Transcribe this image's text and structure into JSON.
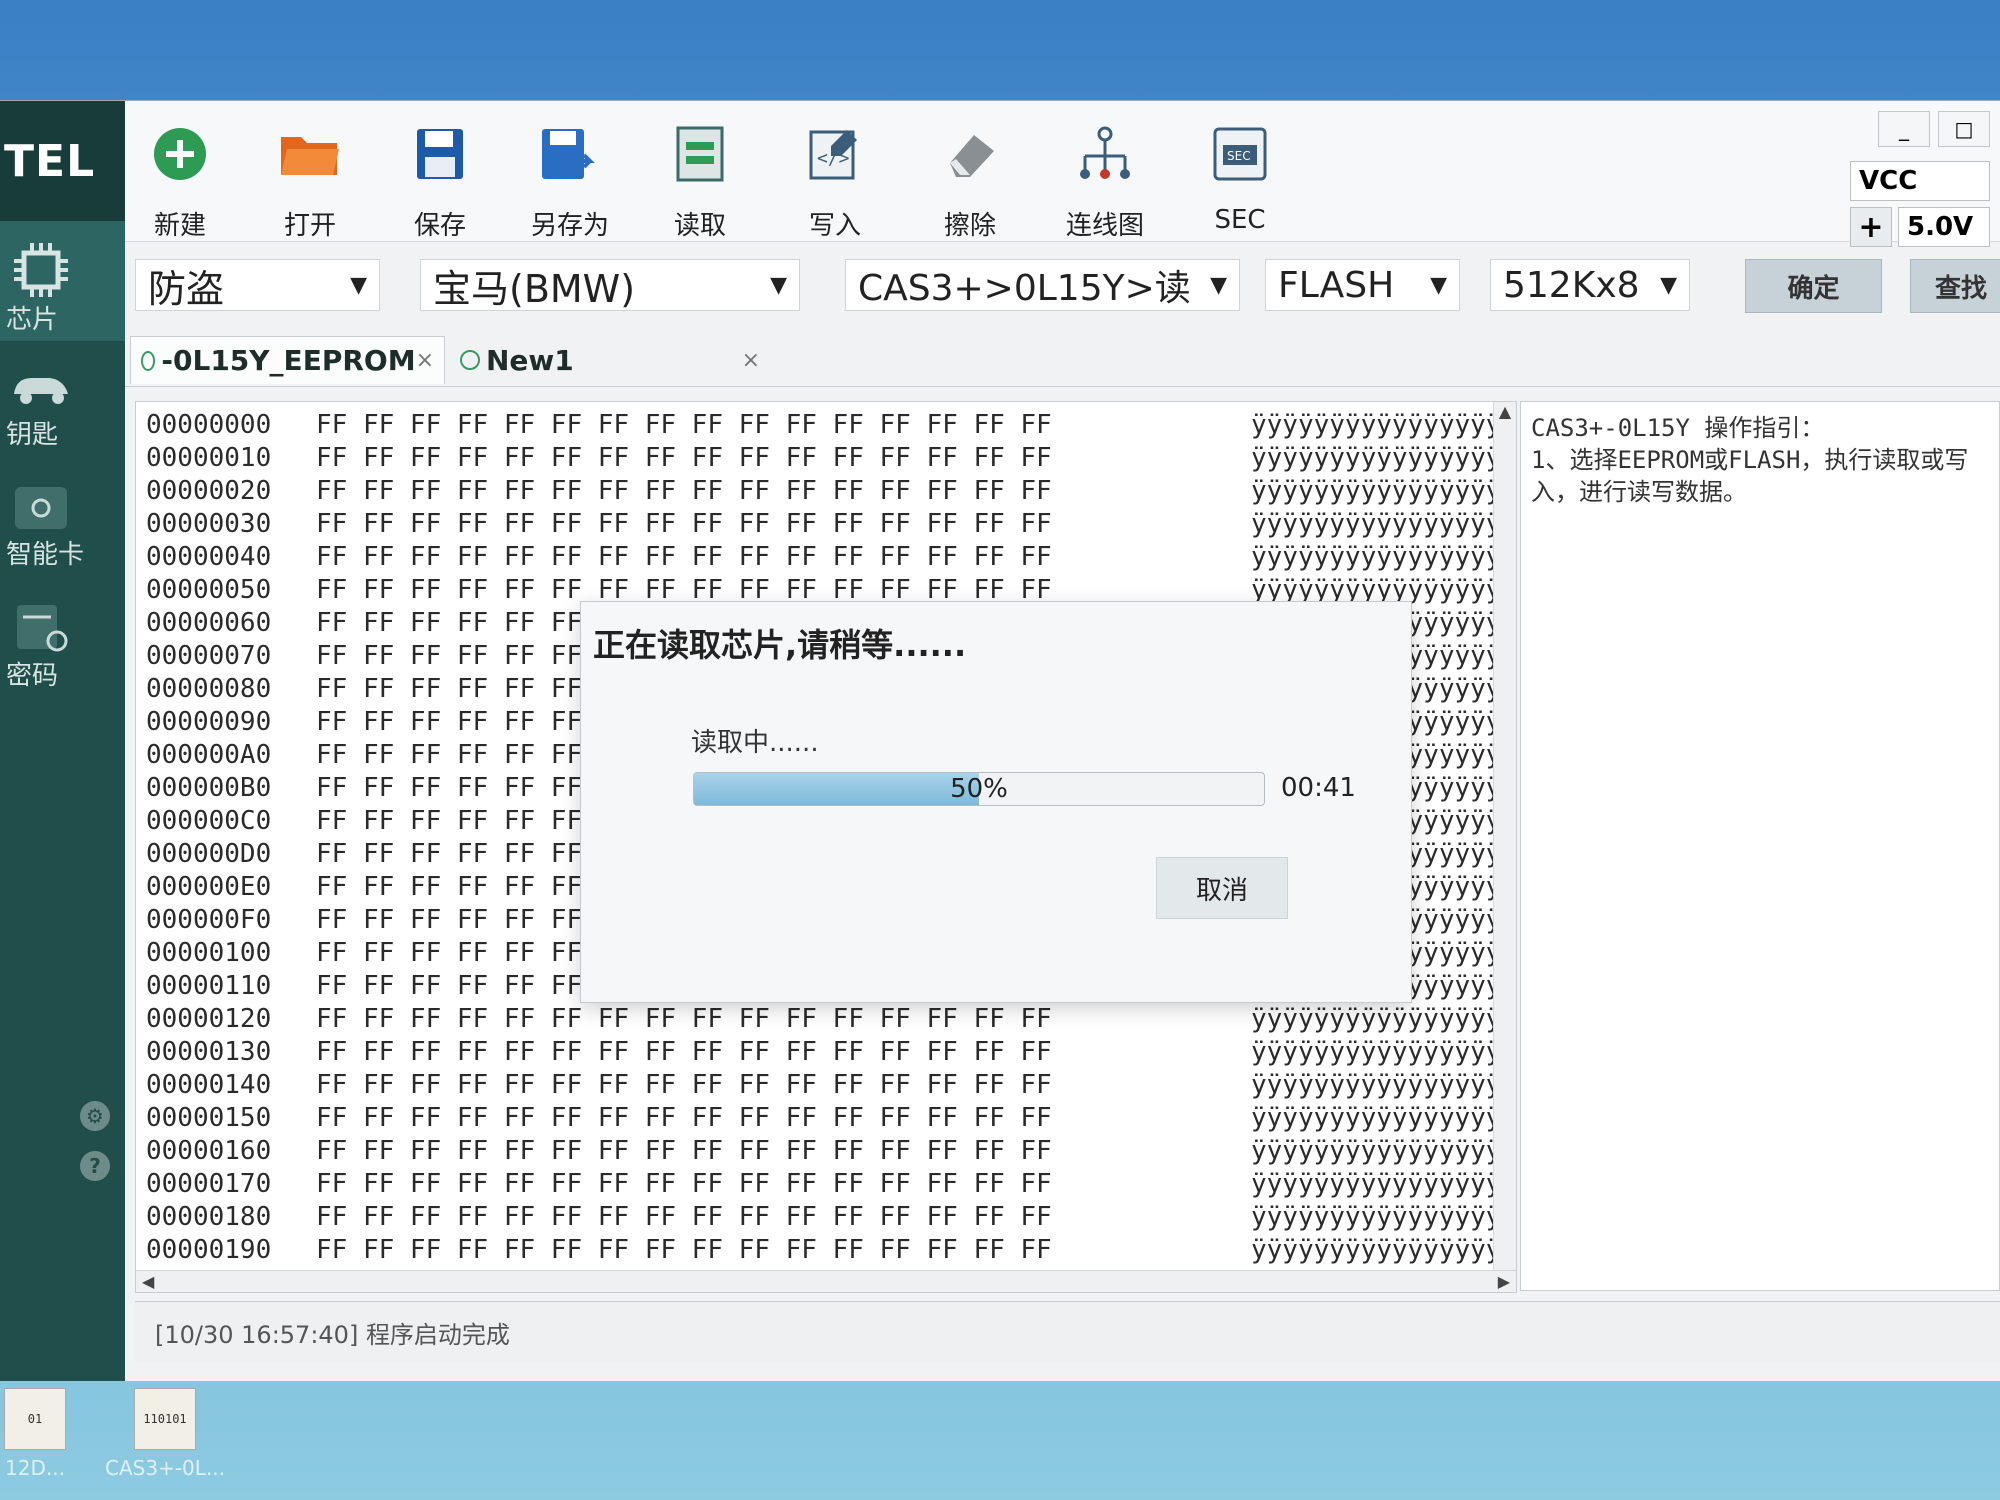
{
  "app": {
    "logo": "TEL"
  },
  "sidebar": {
    "items": [
      {
        "label": "芯片",
        "icon": "chip-icon"
      },
      {
        "label": "钥匙",
        "icon": "car-key-icon"
      },
      {
        "label": "智能卡",
        "icon": "smart-card-icon"
      },
      {
        "label": "密码",
        "icon": "password-icon"
      }
    ],
    "footer_icons": [
      "gear-icon",
      "home-icon",
      "help-icon",
      "info-icon"
    ]
  },
  "toolbar": {
    "buttons": [
      {
        "label": "新建",
        "icon": "new-icon"
      },
      {
        "label": "打开",
        "icon": "folder-icon"
      },
      {
        "label": "保存",
        "icon": "save-icon"
      },
      {
        "label": "另存为",
        "icon": "save-as-icon"
      },
      {
        "label": "读取",
        "icon": "read-icon"
      },
      {
        "label": "写入",
        "icon": "write-icon"
      },
      {
        "label": "擦除",
        "icon": "eraser-icon"
      },
      {
        "label": "连线图",
        "icon": "wiring-icon"
      },
      {
        "label": "SEC",
        "icon": "sec-icon"
      }
    ],
    "vcc": {
      "label": "VCC",
      "plus": "+",
      "value": "5.0V"
    },
    "window_controls": [
      "_",
      "□"
    ]
  },
  "selectors": {
    "category": "防盗",
    "brand": "宝马(BMW)",
    "module": "CAS3+>0L15Y>读",
    "memory": "FLASH",
    "size": "512Kx8",
    "confirm": "确定",
    "search": "查找"
  },
  "tabs": [
    {
      "label": "-0L15Y_EEPROM",
      "close": "×"
    },
    {
      "label": "New1",
      "close": "×"
    }
  ],
  "hex": {
    "rows": [
      {
        "addr": "00000000",
        "bytes": "FF FF FF FF FF FF FF FF FF FF FF FF FF FF FF FF",
        "ascii": "ÿÿÿÿÿÿÿÿÿÿÿÿÿÿÿÿ"
      },
      {
        "addr": "00000010",
        "bytes": "FF FF FF FF FF FF FF FF FF FF FF FF FF FF FF FF",
        "ascii": "ÿÿÿÿÿÿÿÿÿÿÿÿÿÿÿÿ"
      },
      {
        "addr": "00000020",
        "bytes": "FF FF FF FF FF FF FF FF FF FF FF FF FF FF FF FF",
        "ascii": "ÿÿÿÿÿÿÿÿÿÿÿÿÿÿÿÿ"
      },
      {
        "addr": "00000030",
        "bytes": "FF FF FF FF FF FF FF FF FF FF FF FF FF FF FF FF",
        "ascii": "ÿÿÿÿÿÿÿÿÿÿÿÿÿÿÿÿ"
      },
      {
        "addr": "00000040",
        "bytes": "FF FF FF FF FF FF FF FF FF FF FF FF FF FF FF FF",
        "ascii": "ÿÿÿÿÿÿÿÿÿÿÿÿÿÿÿÿ"
      },
      {
        "addr": "00000050",
        "bytes": "FF FF FF FF FF FF FF FF FF FF FF FF FF FF FF FF",
        "ascii": "ÿÿÿÿÿÿÿÿÿÿÿÿÿÿÿÿ"
      },
      {
        "addr": "00000060",
        "bytes": "FF FF FF FF FF FF FF FF FF FF FF FF FF FF FF FF",
        "ascii": "ÿÿÿÿÿÿÿÿÿÿÿÿÿÿÿÿ"
      },
      {
        "addr": "00000070",
        "bytes": "FF FF FF FF FF FF FF FF FF FF FF FF FF FF FF FF",
        "ascii": "ÿÿÿÿÿÿÿÿÿÿÿÿÿÿÿÿ"
      },
      {
        "addr": "00000080",
        "bytes": "FF FF FF FF FF FF FF FF FF FF FF FF FF FF FF FF",
        "ascii": "ÿÿÿÿÿÿÿÿÿÿÿÿÿÿÿÿ"
      },
      {
        "addr": "00000090",
        "bytes": "FF FF FF FF FF FF FF FF FF FF FF FF FF FF FF FF",
        "ascii": "ÿÿÿÿÿÿÿÿÿÿÿÿÿÿÿÿ"
      },
      {
        "addr": "000000A0",
        "bytes": "FF FF FF FF FF FF FF FF FF FF FF FF FF FF FF FF",
        "ascii": "ÿÿÿÿÿÿÿÿÿÿÿÿÿÿÿÿ"
      },
      {
        "addr": "000000B0",
        "bytes": "FF FF FF FF FF FF FF FF FF FF FF FF FF FF FF FF",
        "ascii": "ÿÿÿÿÿÿÿÿÿÿÿÿÿÿÿÿ"
      },
      {
        "addr": "000000C0",
        "bytes": "FF FF FF FF FF FF FF FF FF FF FF FF FF FF FF FF",
        "ascii": "ÿÿÿÿÿÿÿÿÿÿÿÿÿÿÿÿ"
      },
      {
        "addr": "000000D0",
        "bytes": "FF FF FF FF FF FF FF FF FF FF FF FF FF FF FF FF",
        "ascii": "ÿÿÿÿÿÿÿÿÿÿÿÿÿÿÿÿ"
      },
      {
        "addr": "000000E0",
        "bytes": "FF FF FF FF FF FF FF FF FF FF FF FF FF FF FF FF",
        "ascii": "ÿÿÿÿÿÿÿÿÿÿÿÿÿÿÿÿ"
      },
      {
        "addr": "000000F0",
        "bytes": "FF FF FF FF FF FF FF FF FF FF FF FF FF FF FF FF",
        "ascii": "ÿÿÿÿÿÿÿÿÿÿÿÿÿÿÿÿ"
      },
      {
        "addr": "00000100",
        "bytes": "FF FF FF FF FF FF FF FF FF FF FF FF FF FF FF FF",
        "ascii": "ÿÿÿÿÿÿÿÿÿÿÿÿÿÿÿÿ"
      },
      {
        "addr": "00000110",
        "bytes": "FF FF FF FF FF FF FF FF FF FF FF FF FF FF FF FF",
        "ascii": "ÿÿÿÿÿÿÿÿÿÿÿÿÿÿÿÿ"
      },
      {
        "addr": "00000120",
        "bytes": "FF FF FF FF FF FF FF FF FF FF FF FF FF FF FF FF",
        "ascii": "ÿÿÿÿÿÿÿÿÿÿÿÿÿÿÿÿ"
      },
      {
        "addr": "00000130",
        "bytes": "FF FF FF FF FF FF FF FF FF FF FF FF FF FF FF FF",
        "ascii": "ÿÿÿÿÿÿÿÿÿÿÿÿÿÿÿÿ"
      },
      {
        "addr": "00000140",
        "bytes": "FF FF FF FF FF FF FF FF FF FF FF FF FF FF FF FF",
        "ascii": "ÿÿÿÿÿÿÿÿÿÿÿÿÿÿÿÿ"
      },
      {
        "addr": "00000150",
        "bytes": "FF FF FF FF FF FF FF FF FF FF FF FF FF FF FF FF",
        "ascii": "ÿÿÿÿÿÿÿÿÿÿÿÿÿÿÿÿ"
      },
      {
        "addr": "00000160",
        "bytes": "FF FF FF FF FF FF FF FF FF FF FF FF FF FF FF FF",
        "ascii": "ÿÿÿÿÿÿÿÿÿÿÿÿÿÿÿÿ"
      },
      {
        "addr": "00000170",
        "bytes": "FF FF FF FF FF FF FF FF FF FF FF FF FF FF FF FF",
        "ascii": "ÿÿÿÿÿÿÿÿÿÿÿÿÿÿÿÿ"
      },
      {
        "addr": "00000180",
        "bytes": "FF FF FF FF FF FF FF FF FF FF FF FF FF FF FF FF",
        "ascii": "ÿÿÿÿÿÿÿÿÿÿÿÿÿÿÿÿ"
      },
      {
        "addr": "00000190",
        "bytes": "FF FF FF FF FF FF FF FF FF FF FF FF FF FF FF FF",
        "ascii": "ÿÿÿÿÿÿÿÿÿÿÿÿÿÿÿÿ"
      }
    ]
  },
  "guide": {
    "title": "CAS3+-0L15Y 操作指引：",
    "text": "1、选择EEPROM或FLASH，执行读取或写入，进行读写数据。"
  },
  "status": {
    "log": "[10/30 16:57:40] 程序启动完成"
  },
  "dialog": {
    "title": "正在读取芯片,请稍等......",
    "subtitle": "读取中......",
    "progress": 0.5,
    "progress_text": "50%",
    "time": "00:41",
    "cancel": "取消"
  },
  "desktop": {
    "icons": [
      {
        "label": "12D..."
      },
      {
        "label": "CAS3+-0L..."
      }
    ]
  }
}
